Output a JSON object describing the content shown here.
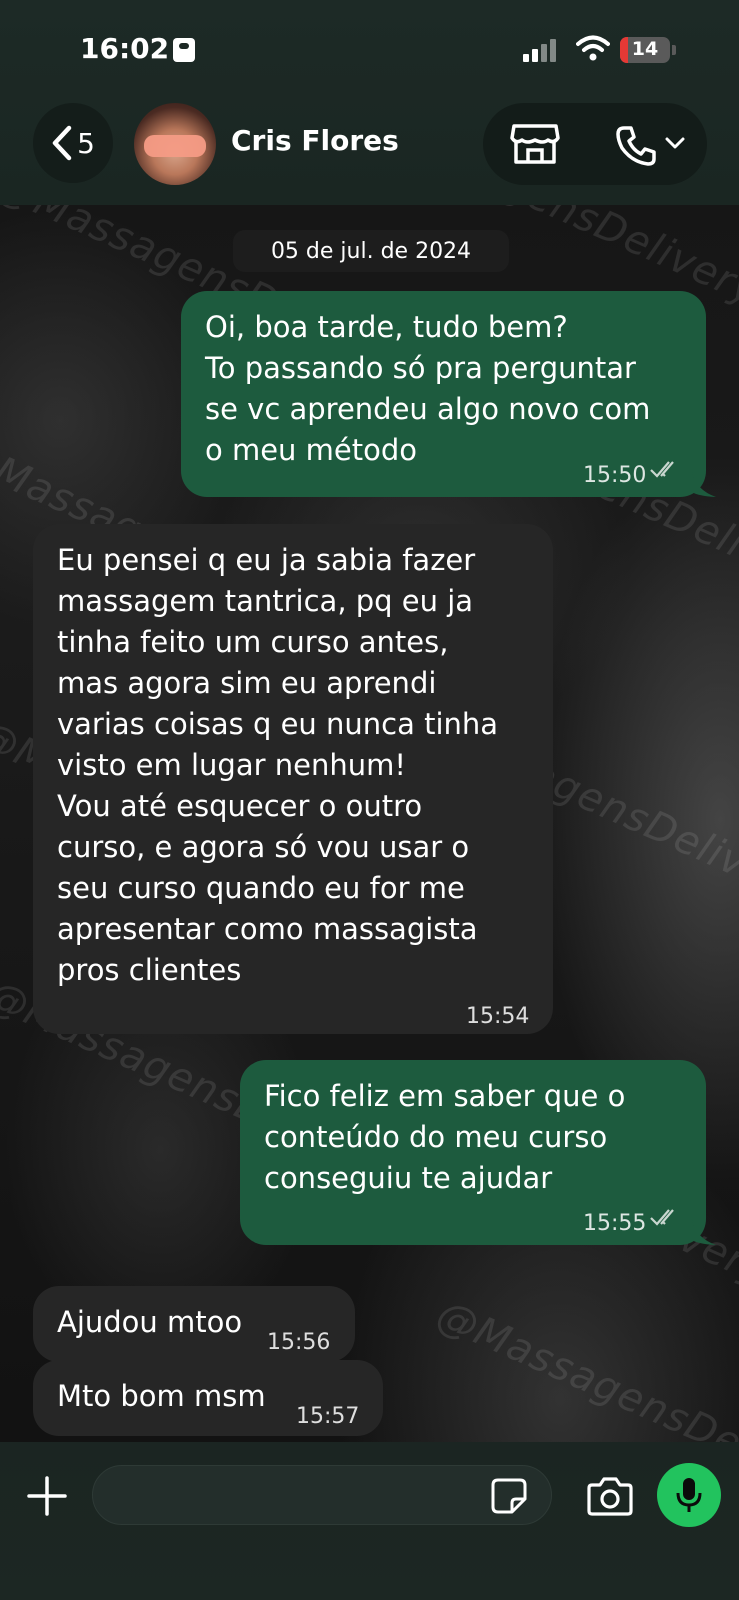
{
  "status_bar": {
    "time": "16:02",
    "battery": "14"
  },
  "header": {
    "back_count": "5",
    "contact_name": "Cris Flores"
  },
  "chat": {
    "date": "05 de jul. de 2024",
    "watermark": "@MassagensDelivery",
    "messages": [
      {
        "direction": "outgoing",
        "text": "Oi, boa tarde, tudo bem?\nTo passando só pra perguntar\nse vc aprendeu algo novo com\no meu método",
        "time": "15:50",
        "status": "read"
      },
      {
        "direction": "incoming",
        "text": "Eu pensei q eu ja sabia fazer\nmassagem tantrica, pq eu ja\ntinha feito um curso antes,\nmas agora sim eu aprendi\nvarias coisas q eu nunca tinha\nvisto em lugar nenhum!\nVou até esquecer o outro\ncurso, e agora só vou usar o\nseu curso quando eu for me\napresentar como massagista\npros clientes",
        "time": "15:54"
      },
      {
        "direction": "outgoing",
        "text": "Fico feliz em saber que o\nconteúdo do meu curso\nconseguiu te ajudar",
        "time": "15:55",
        "status": "read"
      },
      {
        "direction": "incoming",
        "text": "Ajudou mtoo",
        "time": "15:56"
      },
      {
        "direction": "incoming",
        "text": "Mto bom msm",
        "time": "15:57"
      }
    ]
  },
  "composer": {
    "placeholder": ""
  },
  "colors": {
    "outgoing_bubble": "#1d5b3e",
    "incoming_bubble": "#262626",
    "mic_button": "#22c35e",
    "battery_low": "#e53935"
  },
  "icons": {
    "back": "chevron-left-icon",
    "store": "store-icon",
    "call": "phone-icon",
    "attach": "plus-icon",
    "sticker": "sticker-icon",
    "camera": "camera-icon",
    "mic": "mic-icon"
  }
}
